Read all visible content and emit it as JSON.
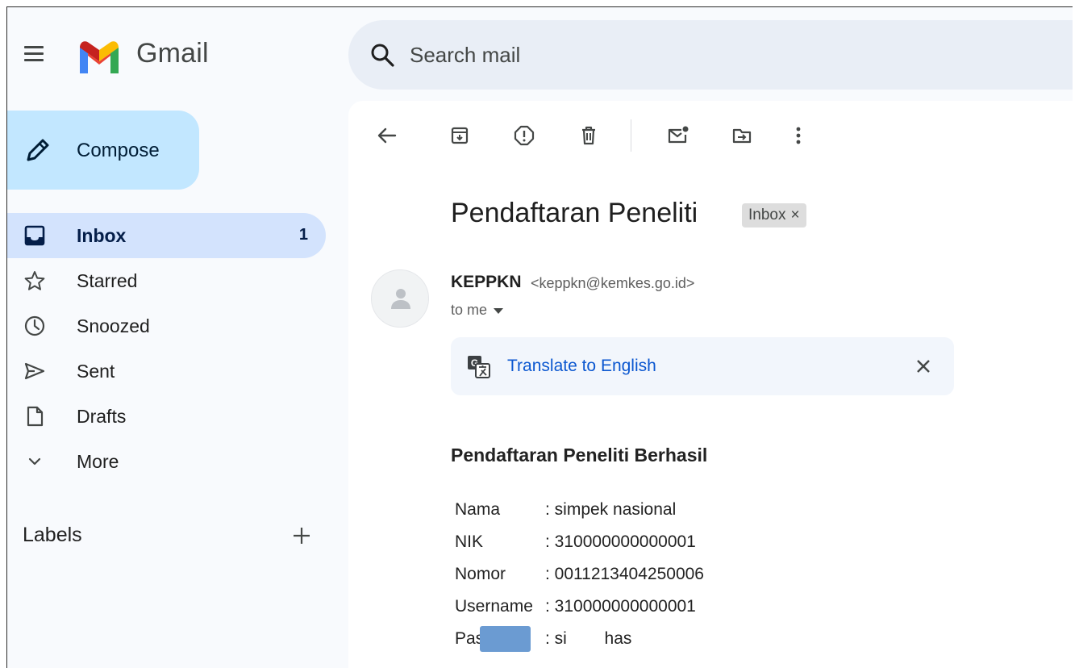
{
  "app": {
    "name": "Gmail",
    "menu_icon": "hamburger-menu-icon",
    "logo_icon": "gmail-logo-icon",
    "colors": {
      "red": "#ea4335",
      "blue": "#4285f4",
      "green": "#34a853",
      "yellow": "#fbbc04",
      "dark_red": "#c5221f"
    }
  },
  "search": {
    "placeholder": "Search mail",
    "icon": "search-icon"
  },
  "compose": {
    "label": "Compose",
    "icon": "pencil-icon",
    "color": "#c2e7ff"
  },
  "nav": [
    {
      "label": "Inbox",
      "icon": "inbox-icon",
      "count": "1",
      "active": true
    },
    {
      "label": "Starred",
      "icon": "star-icon",
      "count": ""
    },
    {
      "label": "Snoozed",
      "icon": "clock-icon",
      "count": ""
    },
    {
      "label": "Sent",
      "icon": "send-icon",
      "count": ""
    },
    {
      "label": "Drafts",
      "icon": "draft-icon",
      "count": ""
    },
    {
      "label": "More",
      "icon": "chevron-down-icon",
      "count": ""
    }
  ],
  "labels": {
    "title": "Labels",
    "add_icon": "plus-icon"
  },
  "toolbar": {
    "icons": [
      "back-arrow-icon",
      "archive-icon",
      "report-spam-icon",
      "delete-icon",
      "mark-unread-icon",
      "move-to-icon",
      "more-vert-icon"
    ]
  },
  "email": {
    "subject": "Pendaftaran Peneliti",
    "label_chip": "Inbox",
    "label_chip_close": "×",
    "sender_name": "KEPPKN",
    "sender_email": "<keppkn@kemkes.go.id>",
    "to": "to me",
    "translate": {
      "link": "Translate to English",
      "icon": "google-translate-icon",
      "close_icon": "close-icon"
    },
    "body": {
      "heading": "Pendaftaran Peneliti Berhasil",
      "fields": [
        {
          "key": "Nama",
          "value": ": simpek nasional"
        },
        {
          "key": "NIK",
          "value": ": 310000000000001"
        },
        {
          "key": "Nomor",
          "value": ": 0011213404250006"
        },
        {
          "key": "Username",
          "value": ": 310000000000001"
        },
        {
          "key": "Password",
          "value": ": si        has"
        }
      ],
      "redaction_color": "#6b9bd2"
    }
  }
}
